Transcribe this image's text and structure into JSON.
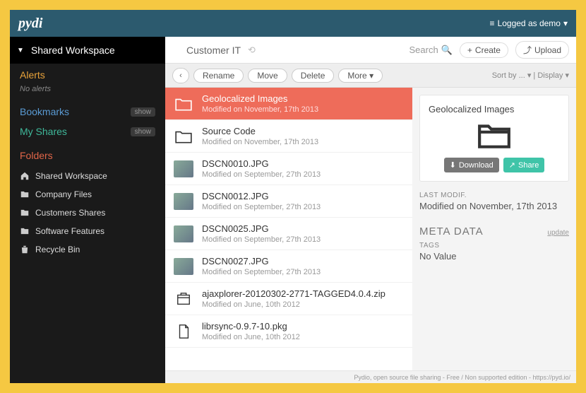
{
  "header": {
    "logo": "pydi",
    "logged": "Logged as demo"
  },
  "sidebar": {
    "workspace": "Shared Workspace",
    "alerts_label": "Alerts",
    "no_alerts": "No alerts",
    "bookmarks_label": "Bookmarks",
    "myshares_label": "My Shares",
    "folders_label": "Folders",
    "show": "show",
    "items": [
      {
        "label": "Shared Workspace",
        "icon": "home"
      },
      {
        "label": "Company Files",
        "icon": "folder"
      },
      {
        "label": "Customers Shares",
        "icon": "folder"
      },
      {
        "label": "Software Features",
        "icon": "folder"
      },
      {
        "label": "Recycle Bin",
        "icon": "trash"
      }
    ]
  },
  "breadcrumb": {
    "path": "Customer IT",
    "search": "Search",
    "create": "Create",
    "upload": "Upload"
  },
  "toolbar": {
    "rename": "Rename",
    "move": "Move",
    "delete": "Delete",
    "more": "More",
    "sort": "Sort by ...",
    "display": "Display"
  },
  "files": [
    {
      "name": "Geolocalized Images",
      "sub": "Modified on November, 17th 2013",
      "type": "folder",
      "selected": true
    },
    {
      "name": "Source Code",
      "sub": "Modified on November, 17th 2013",
      "type": "folder"
    },
    {
      "name": "DSCN0010.JPG",
      "sub": "Modified on September, 27th 2013",
      "type": "img"
    },
    {
      "name": "DSCN0012.JPG",
      "sub": "Modified on September, 27th 2013",
      "type": "img"
    },
    {
      "name": "DSCN0025.JPG",
      "sub": "Modified on September, 27th 2013",
      "type": "img"
    },
    {
      "name": "DSCN0027.JPG",
      "sub": "Modified on September, 27th 2013",
      "type": "img"
    },
    {
      "name": "ajaxplorer-20120302-2771-TAGGED4.0.4.zip",
      "sub": "Modified on June, 10th 2012",
      "type": "zip"
    },
    {
      "name": "librsync-0.9.7-10.pkg",
      "sub": "Modified on June, 10th 2012",
      "type": "pkg"
    }
  ],
  "detail": {
    "title": "Geolocalized Images",
    "download": "Download",
    "share": "Share",
    "last_modif_label": "LAST MODIF.",
    "last_modif": "Modified on November, 17th 2013",
    "meta_title": "META DATA",
    "update": "update",
    "tags_label": "TAGS",
    "tags_value": "No Value"
  },
  "footer": "Pydio, open source file sharing - Free / Non supported edition - https://pyd.io/"
}
